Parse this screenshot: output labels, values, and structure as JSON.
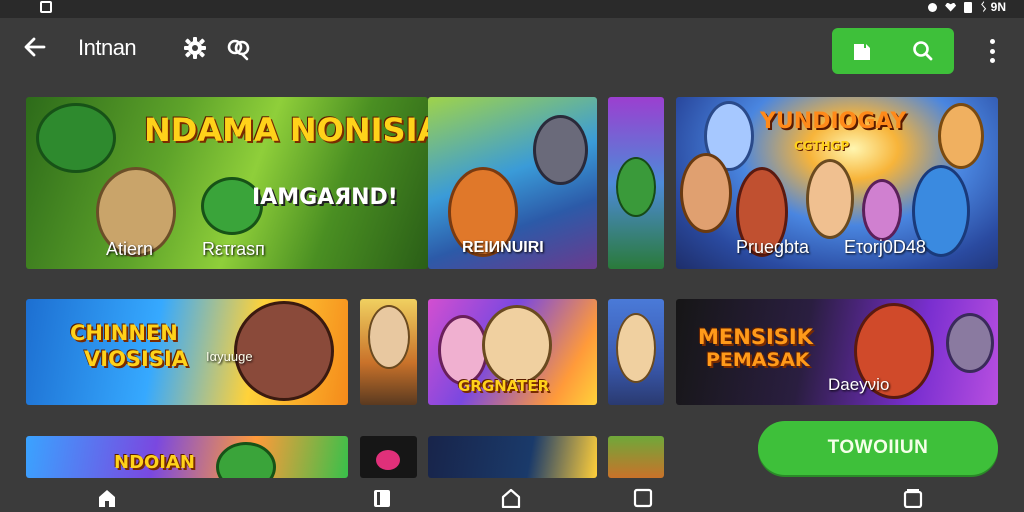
{
  "app": {
    "title": "Intnan"
  },
  "status_bar": {
    "right_text": "ᛊ 9N"
  },
  "toolbar": {
    "icons": [
      "back-arrow-icon",
      "gear-icon",
      "link-icon",
      "bookmark-icon",
      "search-icon",
      "kebab-menu-icon"
    ],
    "accent": "#3ec03a"
  },
  "tiles": [
    {
      "title": "NDAMA NONISIA",
      "subtitle": "IAMGAЯND!",
      "caption_left": "Atiern",
      "caption_right": "Rετrasп"
    },
    {
      "caption": "REIИNUIRI"
    },
    {
      "caption": ""
    },
    {
      "title": "YUNDIOGAY",
      "subtitle": "CGTHGP",
      "caption_left": "Pruegbta",
      "caption_right": "Ετοrj0D48"
    },
    {
      "title_line1": "CHINNEN",
      "title_line2": "VIOSISIA",
      "caption": "Iαyuuge"
    },
    {
      "caption": ""
    },
    {
      "caption": "GRGNATER"
    },
    {
      "caption": ""
    },
    {
      "title_line1": "MENSISIK",
      "title_line2": "PEMASAK",
      "caption": "Daeyνio"
    },
    {
      "title": "NDOIAN"
    },
    {
      "caption": ""
    },
    {
      "caption": ""
    },
    {
      "caption": ""
    }
  ],
  "cta": {
    "label": "TOWOIIUN"
  },
  "navbar": {
    "icons": [
      "home-icon",
      "book-icon",
      "house-outline-icon",
      "square-icon",
      "recents-icon"
    ]
  }
}
